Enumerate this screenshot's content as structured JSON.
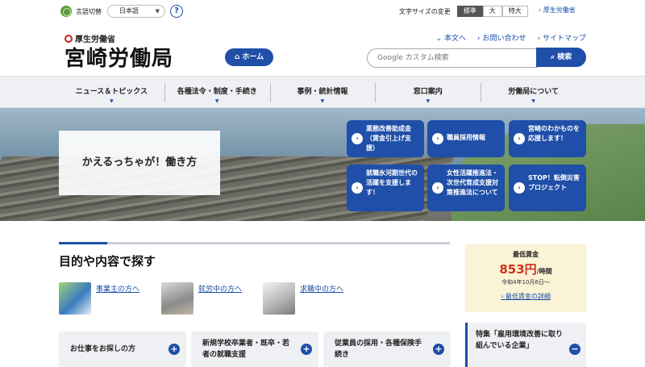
{
  "util": {
    "lang_label": "言語切替",
    "lang_value": "日本語",
    "help": "?",
    "fontsize_label": "文字サイズの変更",
    "fontsize_options": [
      "標準",
      "大",
      "特大"
    ],
    "ministry_link": "厚生労働省"
  },
  "header": {
    "ministry": "厚生労働省",
    "title": "宮崎労働局",
    "home": "ホーム",
    "links": [
      "本文へ",
      "お問い合わせ",
      "サイトマップ"
    ],
    "search_placeholder": "Google カスタム検索",
    "search_button": "検索"
  },
  "gnav": [
    "ニュース＆トピックス",
    "各種法令・制度・手続き",
    "事例・統計情報",
    "窓口案内",
    "労働局について"
  ],
  "hero": {
    "catch": "かえるっちゃが！働き方",
    "tiles": [
      "業務改善助成金（賃金引上げ支援）",
      "職員採用情報",
      "宮崎のわかものを応援します！",
      "就職氷河期世代の活躍を支援します！",
      "女性活躍推進法・次世代育成支援対策推進法について",
      "STOP！転倒災害プロジェクト"
    ]
  },
  "main": {
    "section_title": "目的や内容で探す",
    "personas": [
      "事業主の方へ",
      "就労中の方へ",
      "求職中の方へ"
    ],
    "cards": [
      "お仕事をお探しの方",
      "新規学校卒業者・既卒・若者の就職支援",
      "従業員の採用・各種保険手続き"
    ]
  },
  "side": {
    "wage_title": "最低賃金",
    "wage_amount": "853円",
    "wage_unit": "/時間",
    "wage_date": "令和4年10月6日～",
    "wage_link": "最低賃金の詳細",
    "feature": "特集「雇用環境改善に取り組んでいる企業」"
  },
  "colors": {
    "accent": "#1f4fa8",
    "wage_amount": "#d0321e",
    "wage_bg": "#fbf3d6"
  }
}
